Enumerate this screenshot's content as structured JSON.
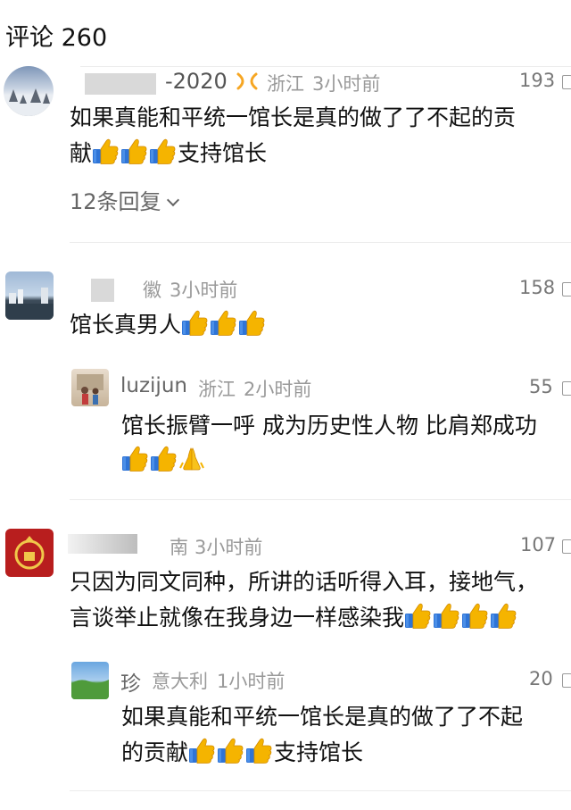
{
  "header": {
    "title": "评论 260"
  },
  "comments": [
    {
      "name_tail": "-2020",
      "location": "浙江",
      "time": "3小时前",
      "likes": "193",
      "text_line1": "如果真能和平统一馆长是真的做了了不起的贡",
      "text_line2_prefix": "献",
      "text_line2_suffix": "支持馆长",
      "replies_link": "12条回复"
    },
    {
      "name_tail": "徽",
      "time": "3小时前",
      "likes": "158",
      "text": "馆长真男人",
      "reply": {
        "username": "luzijun",
        "location": "浙江",
        "time": "2小时前",
        "likes": "55",
        "text_line1": "馆长振臂一呼 成为历史性人物 比肩郑成功"
      }
    },
    {
      "name_tail": "南",
      "time": "3小时前",
      "likes": "107",
      "text_line1": "只因为同文同种，所讲的话听得入耳，接地气，",
      "text_line2": "言谈举止就像在我身边一样感染我",
      "reply": {
        "username": "珍",
        "location": "意大利",
        "time": "1小时前",
        "likes": "20",
        "text_line1": "如果真能和平统一馆长是真的做了了不起",
        "text_line2_prefix": "的贡献",
        "text_line2_suffix": "支持馆长"
      }
    }
  ],
  "icons": {
    "thumbs_up": "thumbs-up-emoji",
    "pray": "pray-emoji",
    "like": "like-icon",
    "chevron": "chevron-down-icon",
    "badge": "vip-badge-icon"
  },
  "colors": {
    "emoji_blue": "#2f74d6",
    "emoji_yellow": "#f5b400",
    "meta_gray": "#9a9a9a",
    "badge_orange": "#f6a623"
  }
}
